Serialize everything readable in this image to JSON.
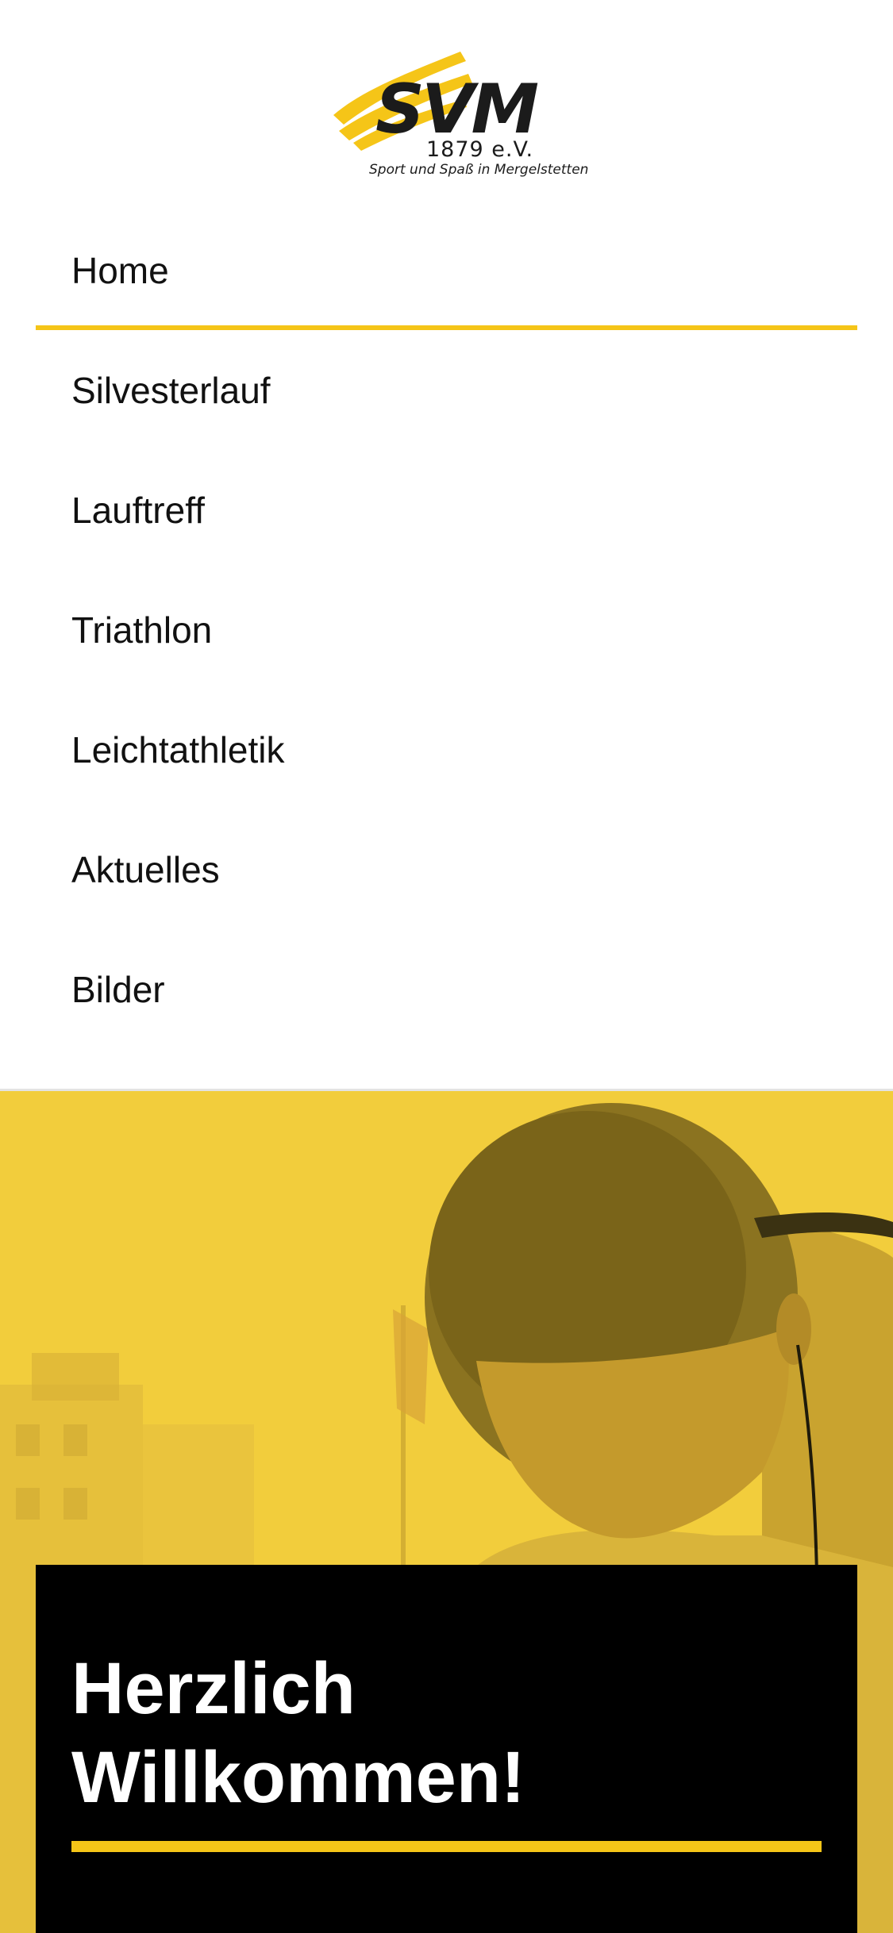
{
  "logo": {
    "mark": "SVM",
    "year": "1879 e.V.",
    "tagline": "Sport und Spaß in Mergelstetten"
  },
  "nav": {
    "items": [
      {
        "label": "Home",
        "active": true
      },
      {
        "label": "Silvesterlauf",
        "active": false
      },
      {
        "label": "Lauftreff",
        "active": false
      },
      {
        "label": "Triathlon",
        "active": false
      },
      {
        "label": "Leichtathletik",
        "active": false
      },
      {
        "label": "Aktuelles",
        "active": false
      },
      {
        "label": "Bilder",
        "active": false
      }
    ]
  },
  "hero": {
    "title_line1": "Herzlich",
    "title_line2": "Willkommen!"
  },
  "colors": {
    "accent": "#f5c518",
    "hero_overlay": "#f2cd3c",
    "text": "#111111",
    "box": "#000000"
  }
}
